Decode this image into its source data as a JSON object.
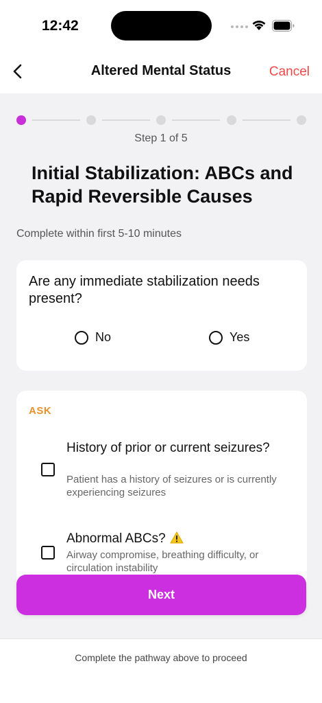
{
  "status_bar": {
    "time": "12:42",
    "icons": [
      "cellular-dots-icon",
      "wifi-icon",
      "battery-icon"
    ]
  },
  "nav": {
    "back_icon": "chevron-left-icon",
    "title": "Altered Mental Status",
    "cancel_label": "Cancel"
  },
  "stepper": {
    "current_step": 1,
    "total_steps": 5,
    "label": "Step 1 of 5"
  },
  "page": {
    "heading": "Initial Stabilization: ABCs and Rapid Reversible Causes",
    "subtext": "Complete within first 5-10 minutes"
  },
  "question_card": {
    "question": "Are any immediate stabilization needs present?",
    "options": [
      {
        "label": "No",
        "selected": false
      },
      {
        "label": "Yes",
        "selected": false
      }
    ]
  },
  "ask_card": {
    "section_label": "ASK",
    "items": [
      {
        "title": "History of prior or current seizures?",
        "description": "Patient has a history of seizures or is currently experiencing seizures",
        "checked": false
      },
      {
        "title": "Abnormal ABCs?",
        "icon": "warning-icon",
        "description": "Airway compromise, breathing difficulty, or circulation instability",
        "checked": false
      }
    ]
  },
  "actions": {
    "next_label": "Next"
  },
  "footer": {
    "text": "Complete the pathway above to proceed"
  },
  "colors": {
    "accent": "#cc2fe0",
    "cancel": "#f04848",
    "ask_label": "#e8922e",
    "step_inactive": "#d9d9dc",
    "background": "#f2f2f4"
  }
}
